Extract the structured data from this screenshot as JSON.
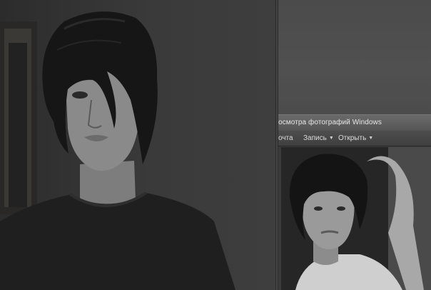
{
  "viewer": {
    "title": "осмотра фотографий Windows",
    "menu": [
      {
        "label": "очта",
        "has_arrow": false
      },
      {
        "label": "Запись",
        "has_arrow": true
      },
      {
        "label": "Открыть",
        "has_arrow": true
      }
    ]
  },
  "colors": {
    "background": "#2b2b2b",
    "title_bar": "#5e5e5e",
    "menu_bar": "#464646",
    "menu_text": "#dcdcdc"
  }
}
